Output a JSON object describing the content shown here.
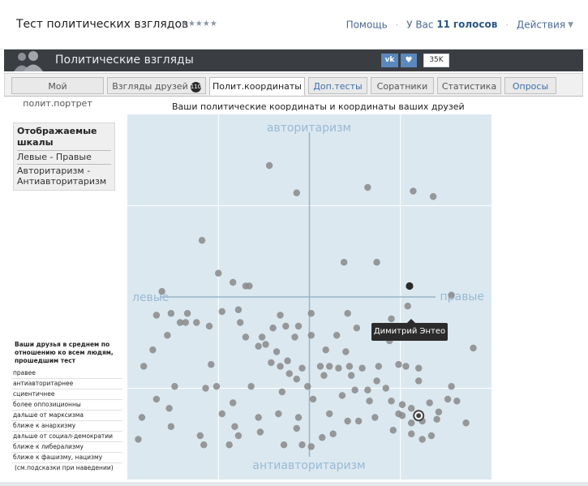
{
  "header": {
    "app_title": "Тест политических взглядов",
    "rating_stars": "★★★★★",
    "help_link": "Помощь",
    "votes_prefix": "У Вас",
    "votes_count": "11",
    "votes_suffix": "голосов",
    "actions_link": "Действия"
  },
  "banner": {
    "title": "Политические взгляды",
    "vk_label": "vk",
    "like_icon": "heart-icon",
    "share_count": "35K"
  },
  "tabs": [
    {
      "label": "Мой полит.портрет",
      "active": false
    },
    {
      "label": "Взгляды друзей",
      "badge": "110",
      "active": false
    },
    {
      "label": "Полит.координаты",
      "active": true
    },
    {
      "label": "Доп.тесты",
      "active": false
    },
    {
      "label": "Соратники",
      "active": false
    },
    {
      "label": "Статистика",
      "active": false
    },
    {
      "label": "Опросы",
      "active": false
    }
  ],
  "main": {
    "chart_title": "Ваши политические координаты и координаты ваших друзей",
    "scales_heading": "Отображаемые шкалы",
    "scales": [
      "Левые - Правые",
      "Авторитаризм - Антиавторитаризм"
    ],
    "avg_title": "Ваши друзья в среднем по отношению ко всем людям, прошедшим тест",
    "avg_items": [
      "правее",
      "антиавторитарнее",
      "сциентичнее",
      "более оппозиционны",
      "дальше от марксизма",
      "ближе к анархизму",
      "дальше от социал-демократии",
      "ближе к либерализму",
      "ближе к фашизму, нацизму"
    ],
    "avg_hint": "(см.подсказки при наведении)",
    "tooltip": "Димитрий Энтео"
  },
  "colors": {
    "plot_bg": "#dbe8f0",
    "grid": "#ffffff",
    "axis": "#9bb4c6",
    "axis_label": "#9ab9d4",
    "point": "#888888",
    "highlight_point": "#2a2a2a"
  },
  "chart_data": {
    "type": "scatter",
    "xlabel_left": "левые",
    "xlabel_right": "правые",
    "ylabel_top": "авторитаризм",
    "ylabel_bottom": "антиавторитаризм",
    "xlim": [
      -10,
      10
    ],
    "ylim": [
      -10,
      10
    ],
    "points": [
      [
        -2.2,
        7.2
      ],
      [
        -0.7,
        5.7
      ],
      [
        3.2,
        6.0
      ],
      [
        5.7,
        5.8
      ],
      [
        6.8,
        5.5
      ],
      [
        -5.9,
        3.1
      ],
      [
        1.9,
        1.9
      ],
      [
        3.7,
        1.9
      ],
      [
        -5.0,
        1.3
      ],
      [
        -4.2,
        0.8
      ],
      [
        -3.5,
        0.6
      ],
      [
        -3.3,
        0.6
      ],
      [
        -8.1,
        0.3
      ],
      [
        7.8,
        0.1
      ],
      [
        5.4,
        -0.5
      ],
      [
        -3.9,
        -0.7
      ],
      [
        -4.8,
        -0.8
      ],
      [
        -6.7,
        -0.9
      ],
      [
        -7.6,
        -0.9
      ],
      [
        -8.4,
        -1.0
      ],
      [
        -7.1,
        -1.4
      ],
      [
        -6.2,
        -1.4
      ],
      [
        -6.8,
        -1.4
      ],
      [
        -5.5,
        -1.6
      ],
      [
        -3.8,
        -1.4
      ],
      [
        -1.6,
        -1.0
      ],
      [
        0.1,
        -0.9
      ],
      [
        2.1,
        -0.9
      ],
      [
        4.5,
        -1.2
      ],
      [
        -0.6,
        -1.6
      ],
      [
        -2.0,
        -1.7
      ],
      [
        -1.3,
        -1.6
      ],
      [
        2.6,
        -1.7
      ],
      [
        1.5,
        -2.1
      ],
      [
        -7.8,
        -2.1
      ],
      [
        -3.5,
        -2.2
      ],
      [
        -2.6,
        -2.2
      ],
      [
        -0.8,
        -2.2
      ],
      [
        0.1,
        -2.1
      ],
      [
        4.4,
        -2.4
      ],
      [
        -2.4,
        -2.6
      ],
      [
        -2.8,
        -2.7
      ],
      [
        -1.8,
        -3.0
      ],
      [
        0.9,
        -2.9
      ],
      [
        2.0,
        -3.0
      ],
      [
        -8.6,
        -2.9
      ],
      [
        9.0,
        -2.8
      ],
      [
        -2.1,
        -3.6
      ],
      [
        -1.2,
        -3.5
      ],
      [
        1.1,
        -3.8
      ],
      [
        2.2,
        -3.8
      ],
      [
        3.8,
        -3.8
      ],
      [
        5.3,
        -3.8
      ],
      [
        6.0,
        -3.9
      ],
      [
        1.6,
        -3.9
      ],
      [
        -1.6,
        -3.8
      ],
      [
        -0.4,
        -3.9
      ],
      [
        0.6,
        -3.8
      ],
      [
        4.9,
        -3.7
      ],
      [
        2.9,
        -3.9
      ],
      [
        -5.4,
        -3.7
      ],
      [
        -9.1,
        -3.8
      ],
      [
        -1.1,
        -4.2
      ],
      [
        0.8,
        -4.3
      ],
      [
        2.3,
        -4.3
      ],
      [
        3.7,
        -4.6
      ],
      [
        6.0,
        -4.6
      ],
      [
        -5.1,
        -4.9
      ],
      [
        -0.7,
        -4.5
      ],
      [
        -0.1,
        -4.9
      ],
      [
        -7.4,
        -4.9
      ],
      [
        -3.2,
        -4.9
      ],
      [
        -1.5,
        -5.2
      ],
      [
        2.5,
        -5.1
      ],
      [
        3.2,
        -5.1
      ],
      [
        4.2,
        -5.0
      ],
      [
        7.8,
        -4.9
      ],
      [
        -5.7,
        -5.0
      ],
      [
        0.2,
        -5.6
      ],
      [
        -8.4,
        -5.6
      ],
      [
        1.8,
        -5.4
      ],
      [
        3.3,
        -5.7
      ],
      [
        4.5,
        -5.7
      ],
      [
        -4.2,
        -5.8
      ],
      [
        5.1,
        -5.9
      ],
      [
        5.6,
        -6.1
      ],
      [
        6.6,
        -5.8
      ],
      [
        7.6,
        -5.6
      ],
      [
        8.1,
        -5.7
      ],
      [
        -4.8,
        -6.4
      ],
      [
        -7.7,
        -6.1
      ],
      [
        -1.7,
        -6.4
      ],
      [
        1.1,
        -6.4
      ],
      [
        4.9,
        -6.4
      ],
      [
        5.1,
        -6.5
      ],
      [
        7.1,
        -6.3
      ],
      [
        -0.6,
        -6.6
      ],
      [
        -2.8,
        -6.6
      ],
      [
        3.6,
        -6.6
      ],
      [
        -9.2,
        -6.6
      ],
      [
        2.1,
        -6.8
      ],
      [
        2.7,
        -6.8
      ],
      [
        5.6,
        -6.9
      ],
      [
        6.2,
        -6.8
      ],
      [
        7.0,
        -6.7
      ],
      [
        8.6,
        -6.9
      ],
      [
        -7.6,
        -7.1
      ],
      [
        -4.1,
        -7.1
      ],
      [
        -0.7,
        -7.2
      ],
      [
        -2.7,
        -7.4
      ],
      [
        1.3,
        -7.5
      ],
      [
        0.7,
        -7.7
      ],
      [
        -6.0,
        -7.6
      ],
      [
        -3.9,
        -7.6
      ],
      [
        -9.4,
        -7.8
      ],
      [
        4.6,
        -7.3
      ],
      [
        5.6,
        -7.5
      ],
      [
        6.7,
        -7.6
      ],
      [
        6.2,
        -7.8
      ],
      [
        -5.8,
        -8.1
      ],
      [
        -4.4,
        -8.1
      ],
      [
        -1.4,
        -8.1
      ],
      [
        -0.4,
        -8.1
      ],
      [
        0.1,
        -8.2
      ]
    ],
    "highlight": [
      5.5,
      0.6
    ],
    "self_marker": [
      6.0,
      -6.5
    ]
  }
}
